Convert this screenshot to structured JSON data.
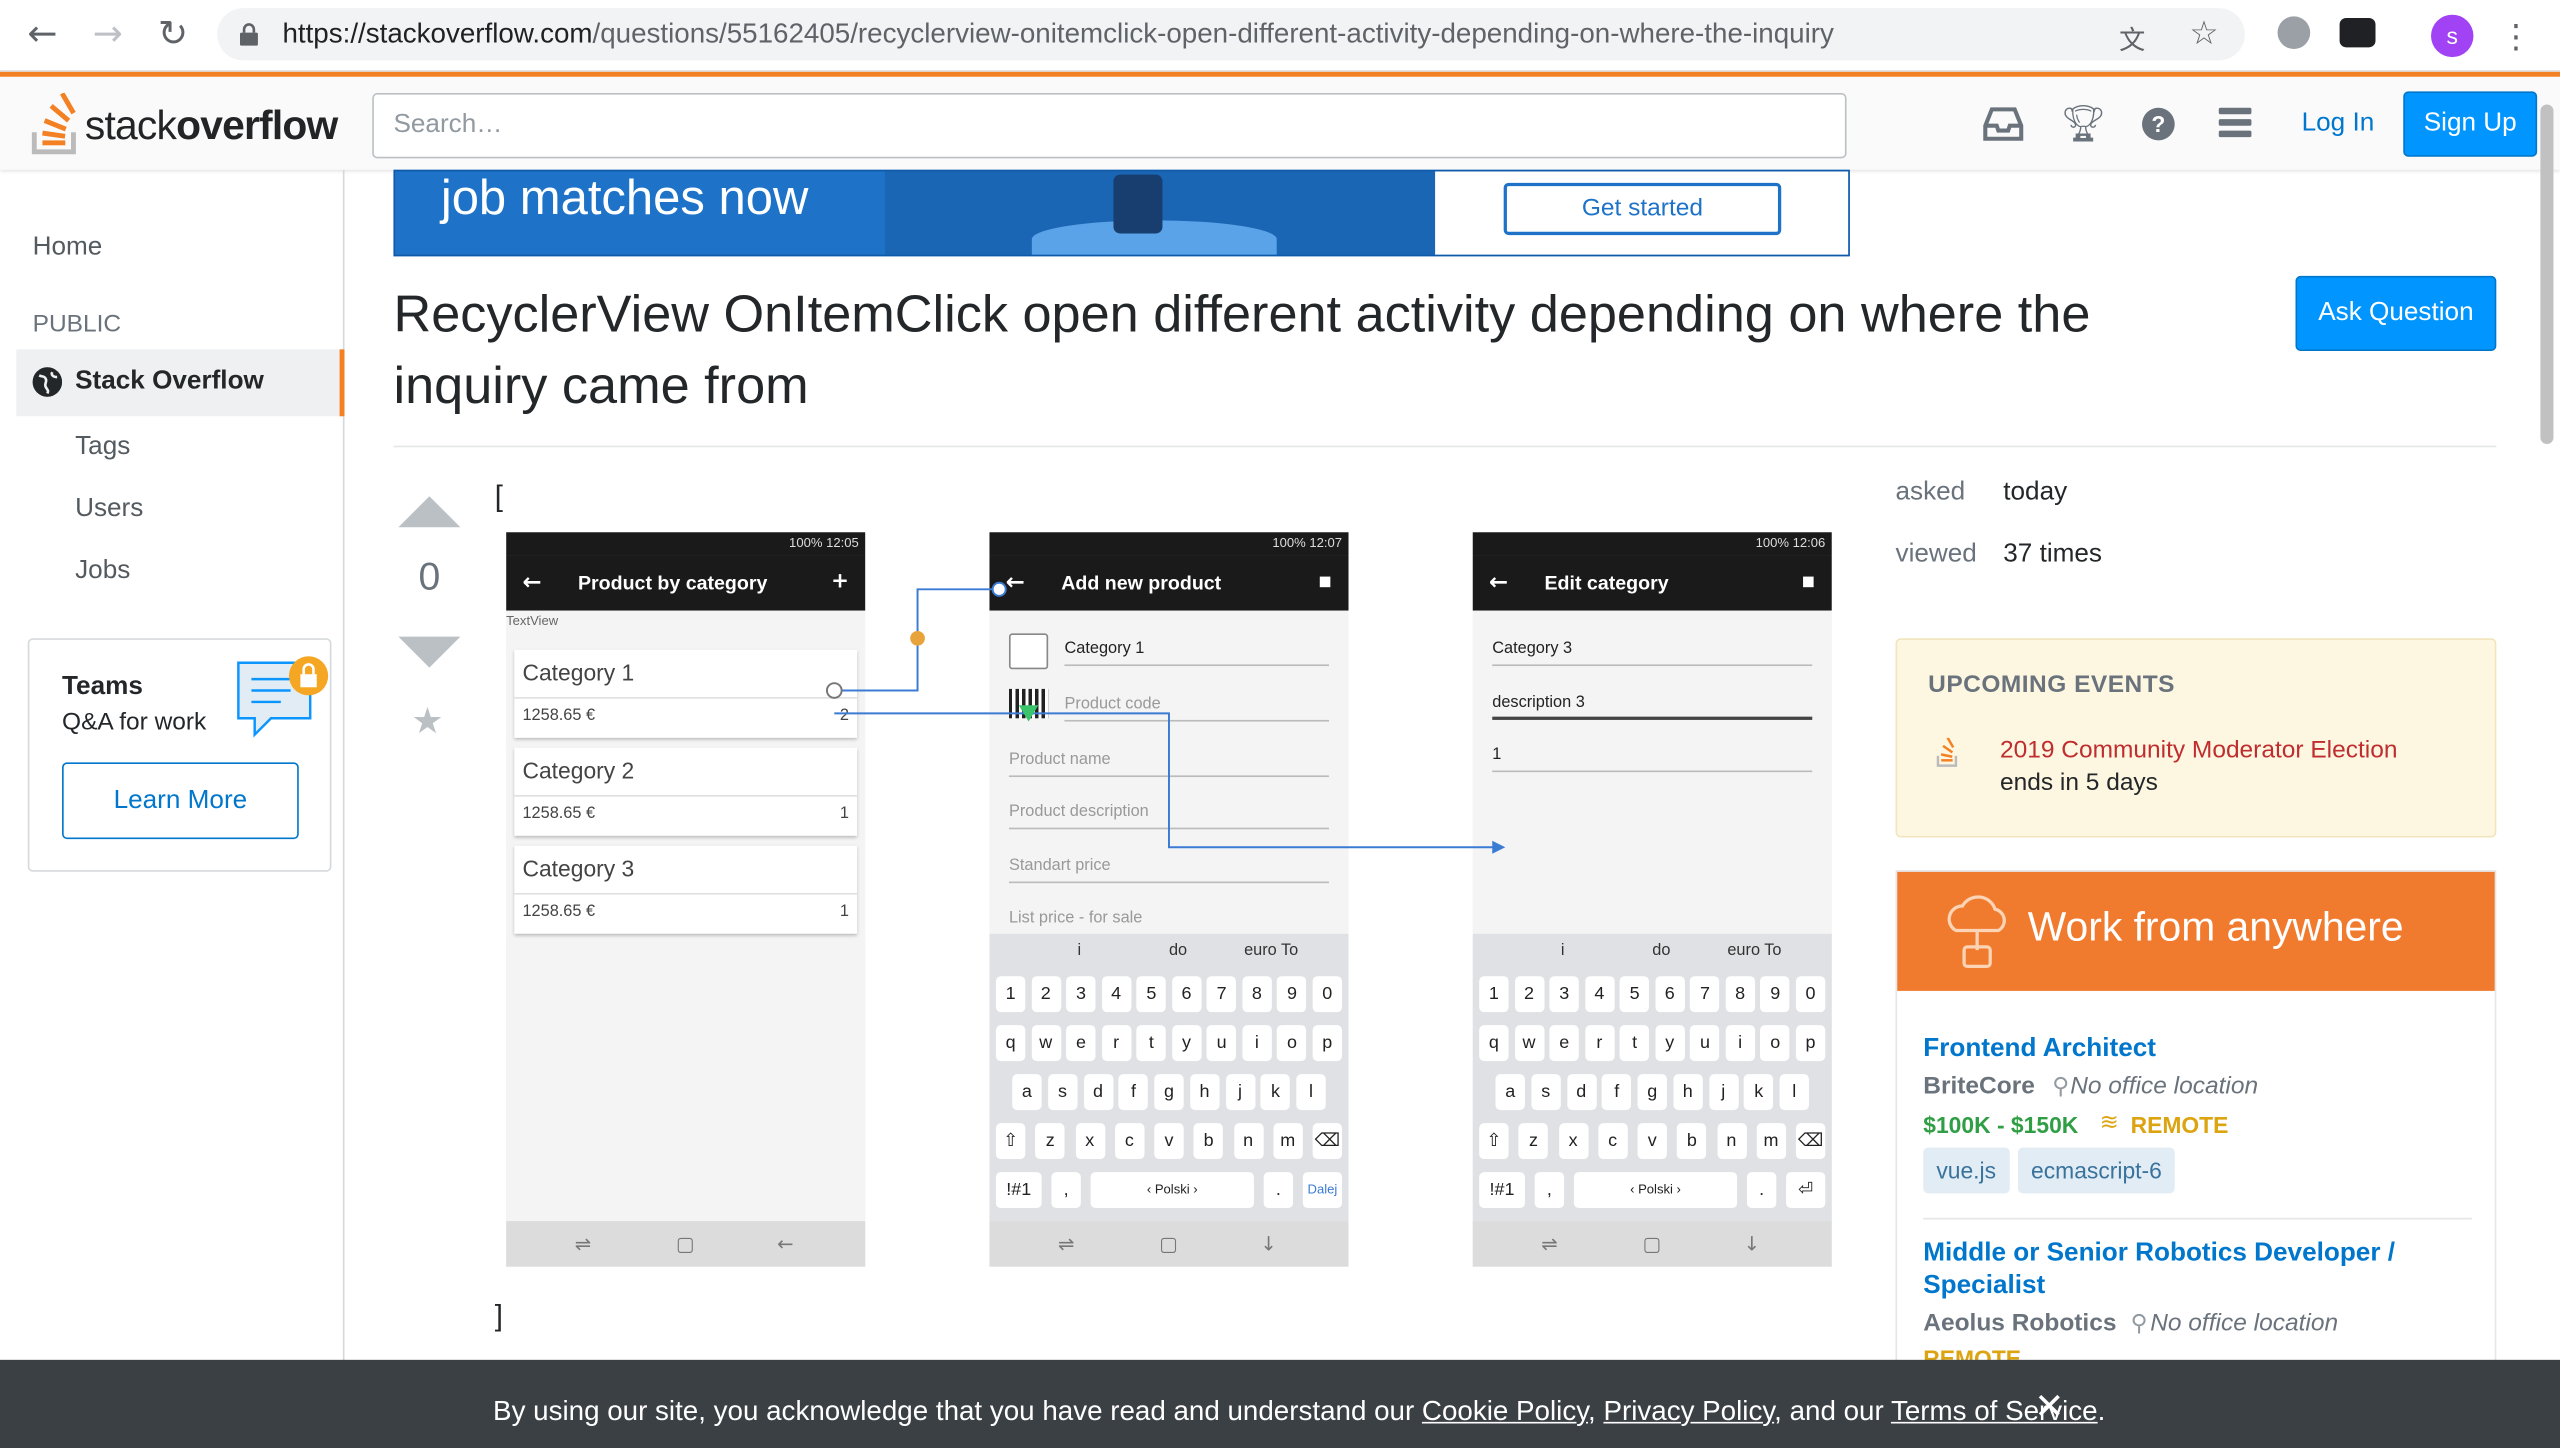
{
  "browser": {
    "url_host": "https://stackoverflow.com",
    "url_path": "/questions/55162405/recyclerview-onitemclick-open-different-activity-depending-on-where-the-inquiry",
    "profile_initial": "s"
  },
  "topbar": {
    "logo_text_light": "stack",
    "logo_text_bold": "overflow",
    "search_placeholder": "Search…",
    "login_label": "Log In",
    "signup_label": "Sign Up"
  },
  "leftnav": {
    "home": "Home",
    "public_heading": "PUBLIC",
    "stack_overflow": "Stack Overflow",
    "tags": "Tags",
    "users": "Users",
    "jobs": "Jobs",
    "teams_title": "Teams",
    "teams_sub": "Q&A for work",
    "learn_more": "Learn More"
  },
  "ad": {
    "text": "job matches now",
    "button": "Get started"
  },
  "question": {
    "title": "RecyclerView OnItemClick open different activity depending on where the inquiry came from",
    "ask_button": "Ask Question",
    "score": "0",
    "body_open": "[",
    "body_close": "]"
  },
  "screens": {
    "status": "100% 12:05",
    "status2": "100% 12:07",
    "status3": "100% 12:06",
    "phone1": {
      "title": "Product by category",
      "hint": "TextView",
      "items": [
        {
          "name": "Category 1",
          "price": "1258.65 €",
          "qty": "2"
        },
        {
          "name": "Category 2",
          "price": "1258.65 €",
          "qty": "1"
        },
        {
          "name": "Category 3",
          "price": "1258.65 €",
          "qty": "1"
        }
      ]
    },
    "phone2": {
      "title": "Add new product",
      "fields": [
        "Category 1",
        "Product code",
        "Product name",
        "Product description",
        "Standart price",
        "List price - for sale"
      ]
    },
    "phone3": {
      "title": "Edit category",
      "fields": [
        "Category 3",
        "description 3",
        "1"
      ]
    },
    "kb_suggest": [
      "i",
      "do",
      "euro To"
    ],
    "kb_rows": [
      [
        "1",
        "2",
        "3",
        "4",
        "5",
        "6",
        "7",
        "8",
        "9",
        "0"
      ],
      [
        "q",
        "w",
        "e",
        "r",
        "t",
        "y",
        "u",
        "i",
        "o",
        "p"
      ],
      [
        "a",
        "s",
        "d",
        "f",
        "g",
        "h",
        "j",
        "k",
        "l"
      ],
      [
        "⇧",
        "z",
        "x",
        "c",
        "v",
        "b",
        "n",
        "m",
        "⌫"
      ]
    ],
    "kb_bottom_left": "!#1",
    "kb_space": "‹ Polski ›",
    "kb_enter2": "Dalej",
    "kb_enter3": "⏎"
  },
  "sidebar": {
    "asked_label": "asked",
    "asked_value": "today",
    "viewed_label": "viewed",
    "viewed_value": "37 times",
    "events_heading": "UPCOMING EVENTS",
    "event_title": "2019 Community Moderator Election",
    "event_sub": "ends in 5 days",
    "jobs_banner": "Work from anywhere",
    "jobs": [
      {
        "title": "Frontend Architect",
        "company": "BriteCore",
        "location": "No office location",
        "salary": "$100K - $150K",
        "remote": "REMOTE",
        "tags": [
          "vue.js",
          "ecmascript-6"
        ]
      },
      {
        "title": "Middle or Senior Robotics Developer / Specialist",
        "company": "Aeolus Robotics",
        "location": "No office location",
        "remote": "REMOTE"
      }
    ]
  },
  "cookie": {
    "prefix": "By using our site, you acknowledge that you have read and understand our ",
    "cookie_policy": "Cookie Policy",
    "sep1": ", ",
    "privacy_policy": "Privacy Policy",
    "sep2": ", and our ",
    "terms": "Terms of Service",
    "suffix": "."
  },
  "colors": {
    "so_orange": "#f48024",
    "so_blue": "#0095ff",
    "link_blue": "#0077cc"
  }
}
